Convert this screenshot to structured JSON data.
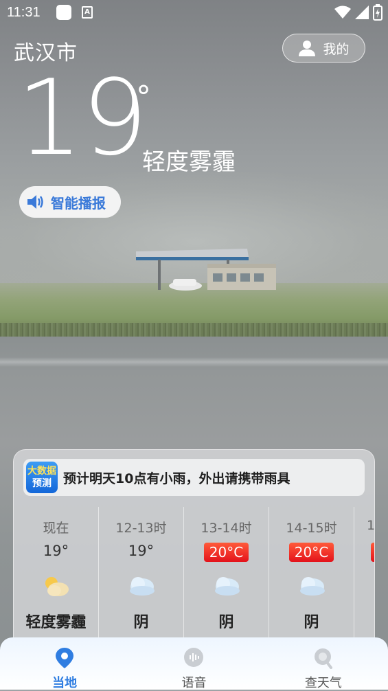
{
  "status_bar": {
    "time": "11:31",
    "icons": [
      "notification-icon",
      "a-icon",
      "wifi-icon",
      "signal-icon",
      "battery-icon"
    ]
  },
  "header": {
    "city": "武汉市",
    "profile_label": "我的"
  },
  "current": {
    "temperature": "19",
    "degree_symbol": "°",
    "condition": "轻度雾霾"
  },
  "broadcast": {
    "label": "智能播报"
  },
  "alert": {
    "badge_line1": "大数据",
    "badge_line2": "预测",
    "text": "预计明天10点有小雨，外出请携带雨具"
  },
  "hourly": [
    {
      "label": "现在",
      "temp": "19°",
      "hot": false,
      "icon": "partly-sunny-icon",
      "condition": "轻度雾霾"
    },
    {
      "label": "12-13时",
      "temp": "19°",
      "hot": false,
      "icon": "cloud-icon",
      "condition": "阴"
    },
    {
      "label": "13-14时",
      "temp": "20°C",
      "hot": true,
      "icon": "cloud-icon",
      "condition": "阴"
    },
    {
      "label": "14-15时",
      "temp": "20°C",
      "hot": true,
      "icon": "cloud-icon",
      "condition": "阴"
    },
    {
      "label": "1",
      "temp": "",
      "hot": true,
      "icon": "",
      "condition": ""
    }
  ],
  "nav": [
    {
      "label": "当地",
      "icon": "location-icon",
      "active": true
    },
    {
      "label": "语音",
      "icon": "voice-icon",
      "active": false
    },
    {
      "label": "查天气",
      "icon": "search-weather-icon",
      "active": false
    }
  ],
  "colors": {
    "accent": "#2f7de1",
    "hot_badge": "#e4121b",
    "broadcast_text": "#3b7ad9"
  }
}
